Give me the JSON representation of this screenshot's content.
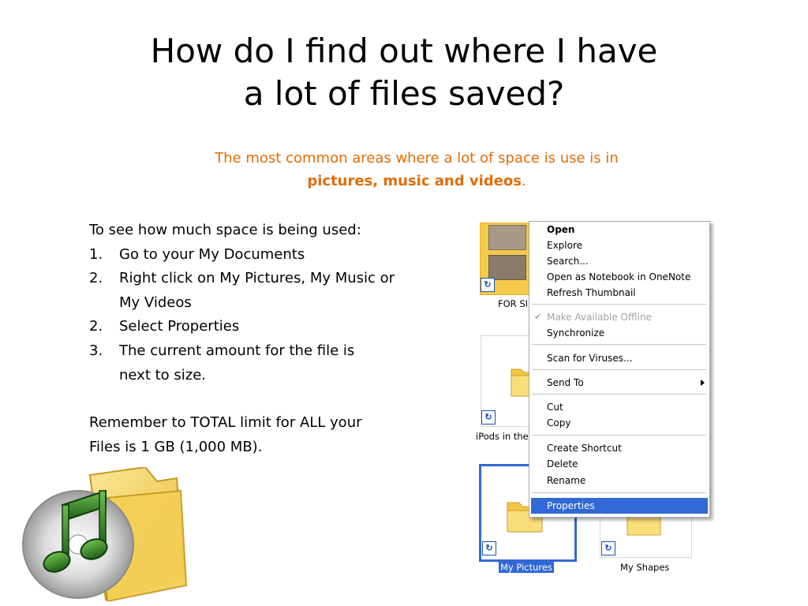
{
  "slide": {
    "title_line1": "How do I find out where I have",
    "title_line2": "a lot of files saved?",
    "subtitle_line1": "The most common areas where a lot of space is use is in",
    "subtitle_bold": "pictures, music and videos",
    "subtitle_end": "."
  },
  "instructions": {
    "intro": "To see how much space is being used:",
    "steps": [
      {
        "num": "1.",
        "text": "Go to your My Documents"
      },
      {
        "num": "2.",
        "text": "Right click on My Pictures, My Music or"
      },
      {
        "num": "",
        "text": "My Videos"
      },
      {
        "num": "2.",
        "text": "Select Properties"
      },
      {
        "num": "3.",
        "text": "The current amount for the file is"
      },
      {
        "num": "",
        "text": "next to size."
      }
    ],
    "reminder_line1": "Remember to TOTAL limit for ALL your",
    "reminder_line2": "Files is 1 GB (1,000 MB)."
  },
  "explorer": {
    "folders": [
      {
        "label": "FOR SI"
      },
      {
        "label": "iPods in the"
      },
      {
        "label": "My Pictures",
        "selected": true
      },
      {
        "label": "My Shapes"
      }
    ]
  },
  "context_menu": {
    "items": {
      "open": "Open",
      "explore": "Explore",
      "search": "Search...",
      "open_onenote": "Open as Notebook in OneNote",
      "refresh_thumb": "Refresh Thumbnail",
      "make_offline": "Make Available Offline",
      "synchronize": "Synchronize",
      "scan_viruses": "Scan for Viruses...",
      "send_to": "Send To",
      "cut": "Cut",
      "copy": "Copy",
      "create_shortcut": "Create Shortcut",
      "delete": "Delete",
      "rename": "Rename",
      "properties": "Properties"
    },
    "highlighted": "Properties"
  },
  "colors": {
    "accent_orange": "#e36c09",
    "selection_blue": "#3168d5",
    "folder_yellow": "#f7d565"
  },
  "icons": [
    "folder-icon",
    "shortcut-arrow-icon",
    "music-folder-icon",
    "submenu-arrow-icon",
    "check-icon"
  ]
}
